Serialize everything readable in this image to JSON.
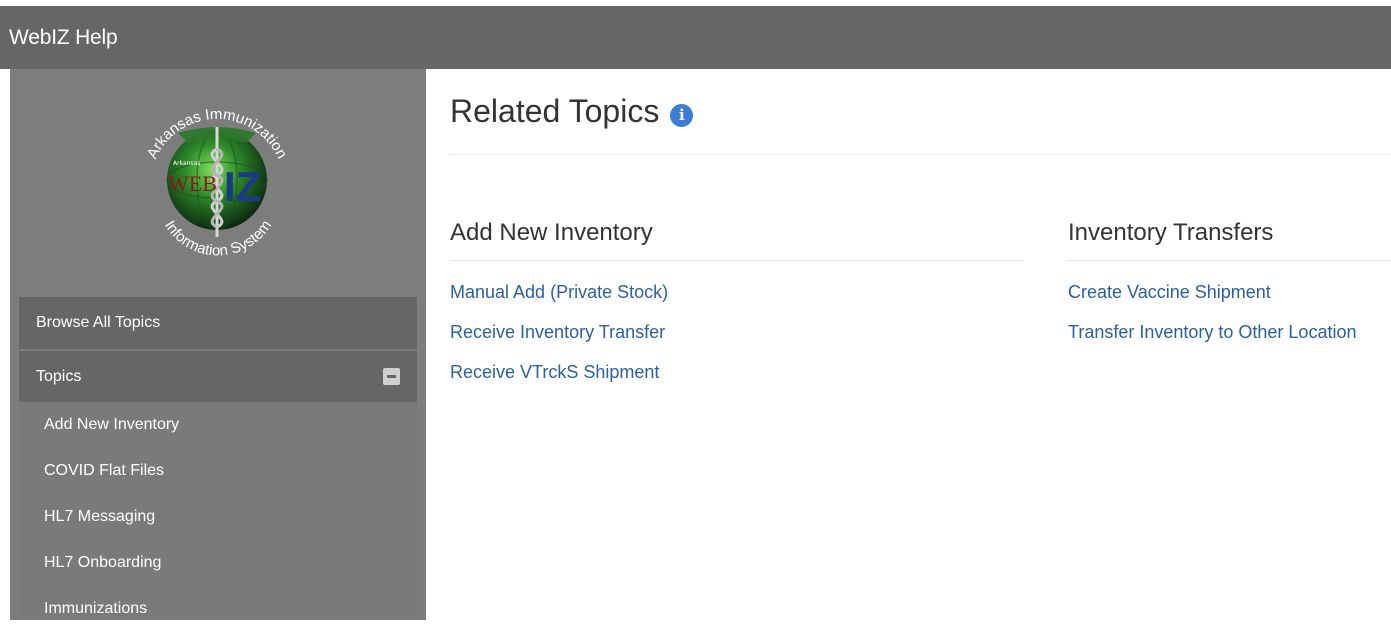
{
  "app": {
    "title": "WebIZ Help"
  },
  "logo": {
    "top_text": "Arkansas Immunization",
    "bottom_text": "Information System",
    "small_text": "Arkansas",
    "web_text": "WEB",
    "iz_text": "IZ"
  },
  "sidebar": {
    "browse_all_label": "Browse All Topics",
    "topics_label": "Topics",
    "topics": [
      "Add New Inventory",
      "COVID Flat Files",
      "HL7 Messaging",
      "HL7 Onboarding",
      "Immunizations"
    ]
  },
  "main": {
    "title": "Related Topics",
    "info_glyph": "i",
    "sections": [
      {
        "heading": "Add New Inventory",
        "links": [
          "Manual Add (Private Stock)",
          "Receive Inventory Transfer",
          "Receive VTrckS Shipment"
        ]
      },
      {
        "heading": "Inventory Transfers",
        "links": [
          "Create Vaccine Shipment",
          "Transfer Inventory to Other Location"
        ]
      }
    ]
  },
  "colors": {
    "header_bg": "#666666",
    "sidebar_bg": "#7d7d7d",
    "link": "#2a5fa5",
    "info_icon": "#3d7dd8"
  }
}
